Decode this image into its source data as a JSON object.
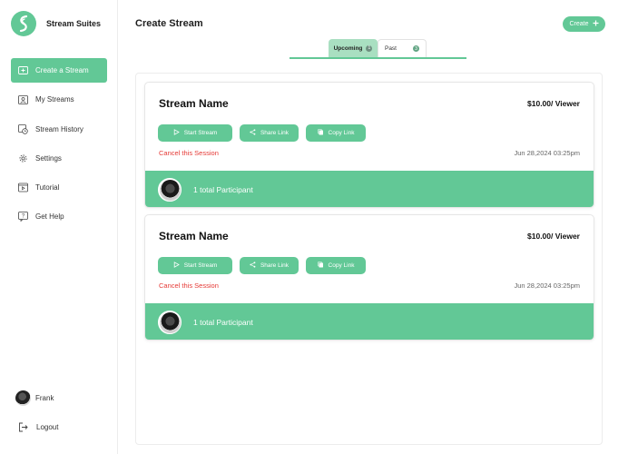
{
  "brand": {
    "name": "Stream Suites"
  },
  "sidebar": {
    "items": [
      {
        "label": "Create a Stream",
        "icon": "create-stream-icon",
        "active": true
      },
      {
        "label": "My Streams",
        "icon": "user-streams-icon",
        "active": false
      },
      {
        "label": "Stream History",
        "icon": "history-icon",
        "active": false
      },
      {
        "label": "Settings",
        "icon": "gear-icon",
        "active": false
      },
      {
        "label": "Tutorial",
        "icon": "tutorial-icon",
        "active": false
      },
      {
        "label": "Get Help",
        "icon": "help-icon",
        "active": false
      }
    ],
    "user_name": "Frank",
    "logout_label": "Logout"
  },
  "header": {
    "title": "Create Stream",
    "create_label": "Create"
  },
  "tabs": [
    {
      "label": "Upcoming",
      "count": "1",
      "active": true
    },
    {
      "label": "Past",
      "count": "3",
      "active": false
    }
  ],
  "streams": [
    {
      "name": "Stream Name",
      "price": "$10.00/ Viewer",
      "start_label": "Start Stream",
      "share_label": "Share Link",
      "copy_label": "Copy Link",
      "cancel_label": "Cancel this Session",
      "date": "Jun 28,2024 03:25pm",
      "participants": "1 total Participant"
    },
    {
      "name": "Stream Name",
      "price": "$10.00/ Viewer",
      "start_label": "Start Stream",
      "share_label": "Share Link",
      "copy_label": "Copy Link",
      "cancel_label": "Cancel this Session",
      "date": "Jun 28,2024 03:25pm",
      "participants": "1 total Participant"
    }
  ],
  "colors": {
    "accent": "#62c896",
    "danger": "#e53935",
    "tab_active_bg": "#a9dfc1"
  }
}
